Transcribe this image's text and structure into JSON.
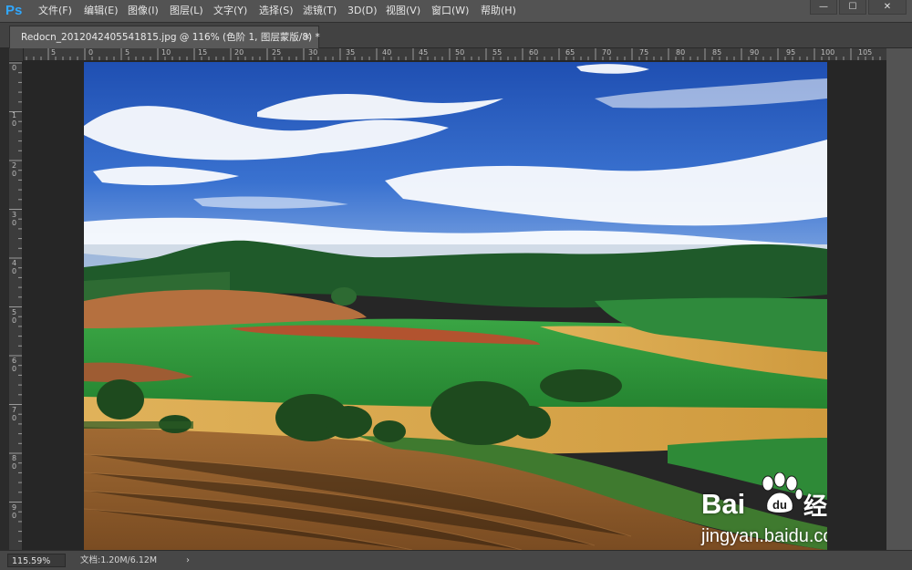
{
  "app": {
    "logo": "Ps"
  },
  "menu": [
    "文件(F)",
    "编辑(E)",
    "图像(I)",
    "图层(L)",
    "文字(Y)",
    "选择(S)",
    "滤镜(T)",
    "3D(D)",
    "视图(V)",
    "窗口(W)",
    "帮助(H)"
  ],
  "window_controls": {
    "minimize": "—",
    "maximize": "☐",
    "close": "✕"
  },
  "document_tab": {
    "title": "Redocn_2012042405541815.jpg @ 116% (色阶 1, 图层蒙版/8) *",
    "close": "×"
  },
  "ruler_top_labels": [
    "5",
    "0",
    "5",
    "10",
    "15",
    "20",
    "25",
    "30",
    "35",
    "40",
    "45",
    "50",
    "55",
    "60",
    "65",
    "70",
    "75",
    "80",
    "85",
    "90",
    "95",
    "100",
    "105"
  ],
  "ruler_left_labels": [
    "0",
    "10",
    "20",
    "30",
    "40",
    "50",
    "60",
    "70",
    "80",
    "90"
  ],
  "status": {
    "zoom": "115.59%",
    "doc_info": "文档:1.20M/6.12M",
    "arrow": "›"
  },
  "watermark": {
    "brand_left": "Bai",
    "brand_right": "经验",
    "url": "jingyan.baidu.com"
  },
  "colors": {
    "ui_bg": "#535353",
    "canvas_bg": "#262626",
    "ps_blue": "#31a8ff",
    "sky": "#2f5fc0",
    "field_green": "#2f9a3a",
    "wheat": "#d9a54a",
    "soil": "#8a5a2c"
  }
}
